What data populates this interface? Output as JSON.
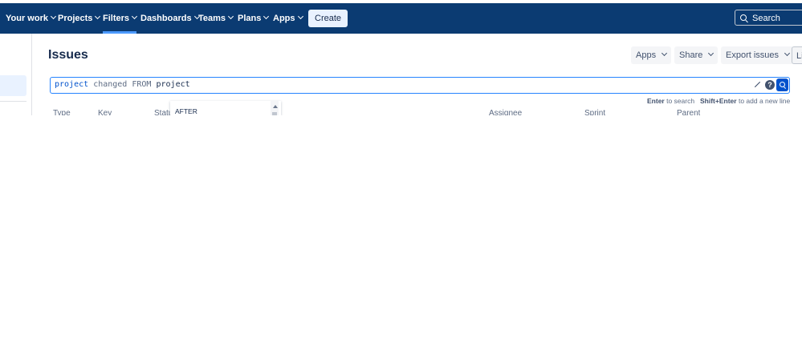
{
  "topnav": {
    "items": [
      {
        "label": "Your work",
        "active": false
      },
      {
        "label": "Projects",
        "active": false
      },
      {
        "label": "Filters",
        "active": true
      },
      {
        "label": "Dashboards",
        "active": false
      },
      {
        "label": "Teams",
        "active": false
      },
      {
        "label": "Plans",
        "active": false
      },
      {
        "label": "Apps",
        "active": false
      }
    ],
    "create_label": "Create",
    "search_label": "Search",
    "background_color": "#0b3b72"
  },
  "page": {
    "title": "Issues",
    "apps_label": "Apps",
    "share_label": "Share",
    "export_label": "Export issues",
    "view_label": "Li"
  },
  "jql": {
    "tokens": [
      "project",
      "changed",
      "FROM",
      "project"
    ],
    "accent_color": "#2684ff"
  },
  "hints": {
    "enter_key": "Enter",
    "enter_text": "to search",
    "shift_key": "Shift+Enter",
    "shift_text": "to add a new line"
  },
  "suggestions": [
    "AFTER"
  ],
  "columns": [
    "Type",
    "Key",
    "Status",
    "Assignee",
    "Sprint",
    "Parent"
  ]
}
